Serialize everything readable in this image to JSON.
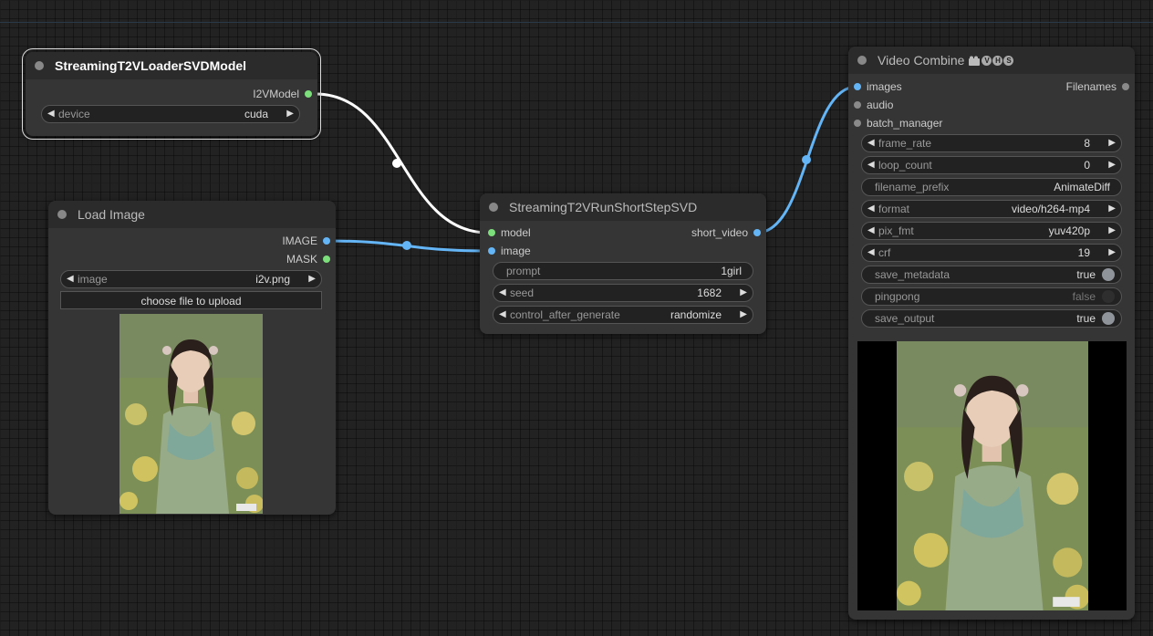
{
  "loader_node": {
    "title": "StreamingT2VLoaderSVDModel",
    "output_label": "I2VModel",
    "device": {
      "label": "device",
      "value": "cuda"
    }
  },
  "load_image_node": {
    "title": "Load Image",
    "outputs": [
      "IMAGE",
      "MASK"
    ],
    "image": {
      "label": "image",
      "value": "i2v.png"
    },
    "upload_label": "choose file to upload"
  },
  "run_node": {
    "title": "StreamingT2VRunShortStepSVD",
    "inputs": [
      "model",
      "image"
    ],
    "output_label": "short_video",
    "prompt": {
      "label": "prompt",
      "value": "1girl"
    },
    "seed": {
      "label": "seed",
      "value": "1682"
    },
    "control": {
      "label": "control_after_generate",
      "value": "randomize"
    }
  },
  "video_node": {
    "title": "Video Combine",
    "badges": [
      "V",
      "H",
      "S"
    ],
    "inputs": [
      "images",
      "audio",
      "batch_manager"
    ],
    "output_label": "Filenames",
    "widgets": [
      {
        "label": "frame_rate",
        "value": "8"
      },
      {
        "label": "loop_count",
        "value": "0"
      },
      {
        "label": "filename_prefix",
        "value": "AnimateDiff"
      },
      {
        "label": "format",
        "value": "video/h264-mp4"
      },
      {
        "label": "pix_fmt",
        "value": "yuv420p"
      },
      {
        "label": "crf",
        "value": "19"
      },
      {
        "label": "save_metadata",
        "value": "true"
      },
      {
        "label": "pingpong",
        "value": "false"
      },
      {
        "label": "save_output",
        "value": "true"
      }
    ]
  },
  "icons": {
    "arrow_left": "◀",
    "arrow_right": "▶"
  },
  "colors": {
    "model_slot": "#7cdf7c",
    "image_slot": "#64b5f6",
    "model_link": "#ffffff",
    "image_link": "#64b5f6",
    "inactive_slot": "#8a8a8a"
  }
}
